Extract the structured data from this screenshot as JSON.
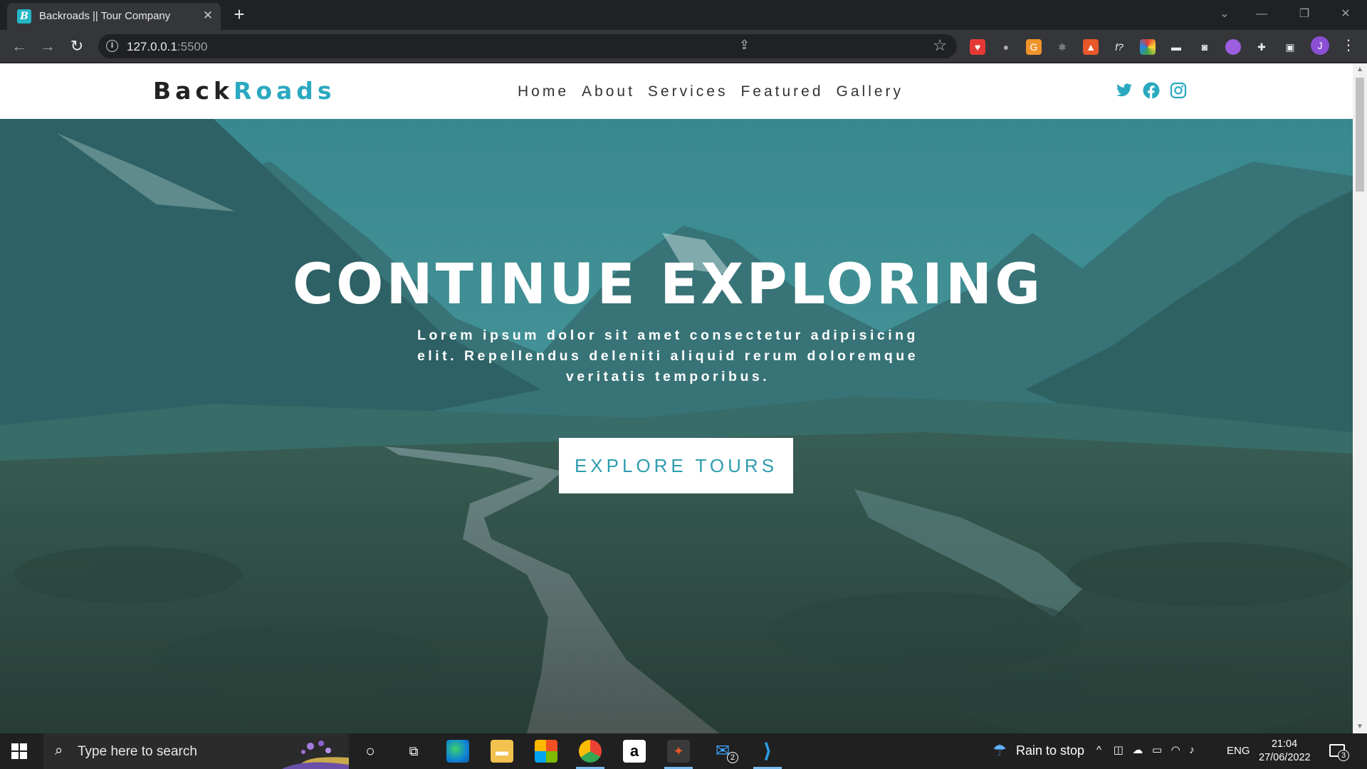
{
  "browser": {
    "tab_title": "Backroads || Tour Company",
    "tab_favicon_letter": "B",
    "url_host": "127.0.0.1",
    "url_port": ":5500",
    "profile_initial": "J"
  },
  "site": {
    "logo_back": "Back",
    "logo_roads": "Roads",
    "accent_color": "#2aa9c0",
    "nav": [
      {
        "label": "Home"
      },
      {
        "label": "About"
      },
      {
        "label": "Services"
      },
      {
        "label": "Featured"
      },
      {
        "label": "Gallery"
      }
    ],
    "socials": [
      "twitter-icon",
      "facebook-icon",
      "instagram-icon"
    ],
    "hero": {
      "title": "CONTINUE EXPLORING",
      "subtitle": "Lorem ipsum dolor sit amet consectetur adipisicing elit. Repellendus deleniti aliquid rerum doloremque veritatis temporibus.",
      "button": "EXPLORE TOURS"
    }
  },
  "taskbar": {
    "search_placeholder": "Type here to search",
    "weather": "Rain to stop",
    "language": "ENG",
    "time": "21:04",
    "date": "27/06/2022",
    "mail_badge": "2",
    "notification_count": "3"
  }
}
